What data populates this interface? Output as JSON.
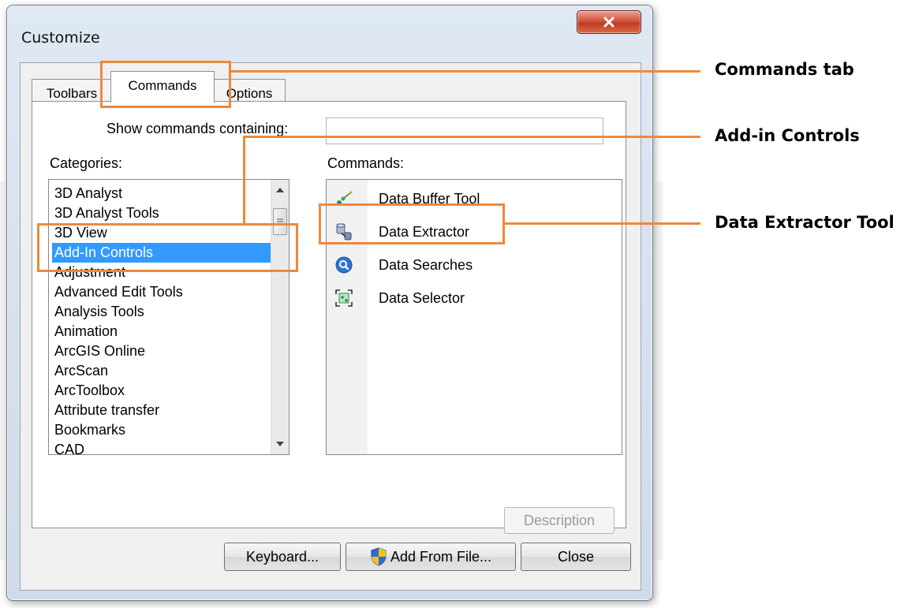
{
  "window": {
    "title": "Customize"
  },
  "tabs": [
    {
      "label": "Toolbars"
    },
    {
      "label": "Commands"
    },
    {
      "label": "Options"
    }
  ],
  "search": {
    "label": "Show commands containing:",
    "value": ""
  },
  "categories": {
    "label": "Categories:",
    "items": [
      "3D Analyst",
      "3D Analyst Tools",
      "3D View",
      "Add-In Controls",
      "Adjustment",
      "Advanced Edit Tools",
      "Analysis Tools",
      "Animation",
      "ArcGIS Online",
      "ArcScan",
      "ArcToolbox",
      "Attribute transfer",
      "Bookmarks",
      "CAD"
    ],
    "selected": "Add-In Controls"
  },
  "commands": {
    "label": "Commands:",
    "items": [
      {
        "label": "Data Buffer Tool",
        "icon": "buffer-tool-icon"
      },
      {
        "label": "Data Extractor",
        "icon": "extractor-icon"
      },
      {
        "label": "Data Searches",
        "icon": "magnifier-icon"
      },
      {
        "label": "Data Selector",
        "icon": "selector-icon"
      }
    ]
  },
  "buttons": {
    "description": "Description",
    "keyboard": "Keyboard...",
    "add_from_file": "Add From File...",
    "close": "Close"
  },
  "annotations": {
    "commands_tab": "Commands tab",
    "addin_controls": "Add-in Controls",
    "data_extractor": "Data Extractor Tool",
    "color": "#f0883a"
  }
}
